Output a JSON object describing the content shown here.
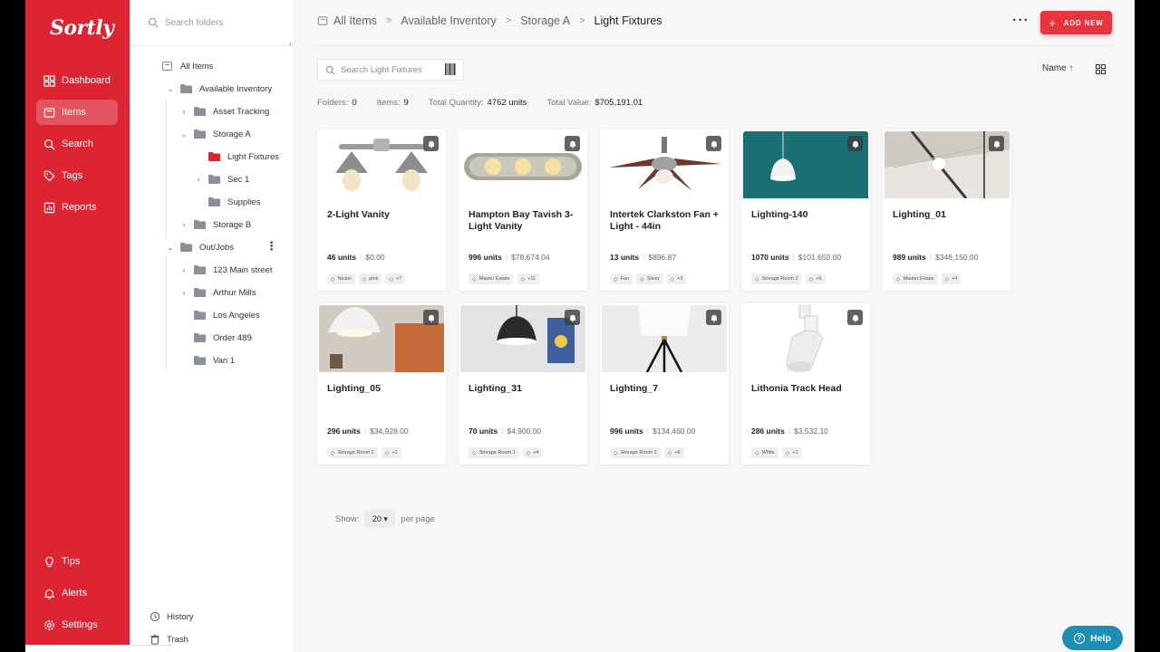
{
  "app": {
    "logo": "Sortly"
  },
  "nav": {
    "items": [
      {
        "label": "Dashboard",
        "icon": "dashboard-icon"
      },
      {
        "label": "Items",
        "icon": "items-icon",
        "active": true
      },
      {
        "label": "Search",
        "icon": "search-icon"
      },
      {
        "label": "Tags",
        "icon": "tag-icon"
      },
      {
        "label": "Reports",
        "icon": "reports-icon"
      }
    ],
    "bottom": [
      {
        "label": "Tips",
        "icon": "lightbulb-icon"
      },
      {
        "label": "Alerts",
        "icon": "bell-icon"
      },
      {
        "label": "Settings",
        "icon": "gear-icon"
      }
    ]
  },
  "tree": {
    "search_placeholder": "Search folders",
    "rows": [
      {
        "label": "All Items",
        "level": 0,
        "chevron": "",
        "kind": "all"
      },
      {
        "label": "Available Inventory",
        "level": 1,
        "chevron": "v",
        "kind": "folder"
      },
      {
        "label": "Asset Tracking",
        "level": 2,
        "chevron": ">",
        "kind": "folder"
      },
      {
        "label": "Storage A",
        "level": 2,
        "chevron": "v",
        "kind": "folder"
      },
      {
        "label": "Light Fixtures",
        "level": 3,
        "chevron": "",
        "kind": "folder-active"
      },
      {
        "label": "Sec 1",
        "level": 3,
        "chevron": ">",
        "kind": "folder"
      },
      {
        "label": "Supplies",
        "level": 3,
        "chevron": "",
        "kind": "folder"
      },
      {
        "label": "Storage B",
        "level": 2,
        "chevron": ">",
        "kind": "folder"
      },
      {
        "label": "Out/Jobs",
        "level": 1,
        "chevron": "v",
        "kind": "folder"
      },
      {
        "label": "123 Main street",
        "level": 2,
        "chevron": ">",
        "kind": "folder"
      },
      {
        "label": "Arthur Mills",
        "level": 2,
        "chevron": ">",
        "kind": "folder"
      },
      {
        "label": "Los Angeles",
        "level": 2,
        "chevron": "",
        "kind": "folder"
      },
      {
        "label": "Order 489",
        "level": 2,
        "chevron": "",
        "kind": "folder"
      },
      {
        "label": "Van 1",
        "level": 2,
        "chevron": "",
        "kind": "folder"
      }
    ],
    "history": "History",
    "trash": "Trash"
  },
  "breadcrumb": [
    "All Items",
    "Available Inventory",
    "Storage A",
    "Light Fixtures"
  ],
  "toolbar": {
    "add_new": "ADD NEW",
    "search_placeholder": "Search Light Fixtures",
    "sort_label": "Name ↑"
  },
  "stats": {
    "folders_label": "Folders:",
    "folders": "0",
    "items_label": "Items:",
    "items": "9",
    "qty_label": "Total Quantity:",
    "qty": "4762 units",
    "value_label": "Total Value:",
    "value": "$705,191.01"
  },
  "items": [
    {
      "name": "2-Light Vanity",
      "units": "46 units",
      "price": "$0.00",
      "tags": [
        "Nickel",
        "pink",
        "+7"
      ],
      "img": "vanity2"
    },
    {
      "name": "Hampton Bay Tavish 3-Light Vanity",
      "units": "996 units",
      "price": "$78,674.04",
      "tags": [
        "Master Estate",
        "+11"
      ],
      "img": "vanity3"
    },
    {
      "name": "Intertek Clarkston Fan + Light - 44in",
      "units": "13 units",
      "price": "$896.87",
      "tags": [
        "Fan",
        "Silver",
        "+3"
      ],
      "img": "fan"
    },
    {
      "name": "Lighting-140",
      "units": "1070 units",
      "price": "$101,650.00",
      "tags": [
        "Storage Room 2",
        "+6"
      ],
      "img": "teal"
    },
    {
      "name": "Lighting_01",
      "units": "989 units",
      "price": "$346,150.00",
      "tags": [
        "Master Estate",
        "+4"
      ],
      "img": "ceiling"
    },
    {
      "name": "Lighting_05",
      "units": "296 units",
      "price": "$34,928.00",
      "tags": [
        "Storage Room 2",
        "+1"
      ],
      "img": "pendant-white"
    },
    {
      "name": "Lighting_31",
      "units": "70 units",
      "price": "$4,900.00",
      "tags": [
        "Storage Room 1",
        "+4"
      ],
      "img": "pendant-black"
    },
    {
      "name": "Lighting_7",
      "units": "996 units",
      "price": "$134,460.00",
      "tags": [
        "Storage Room 2",
        "+8"
      ],
      "img": "floor-lamp"
    },
    {
      "name": "Lithonia Track Head",
      "units": "286 units",
      "price": "$3,532.10",
      "tags": [
        "White",
        "+1"
      ],
      "img": "track"
    }
  ],
  "pagination": {
    "show": "Show:",
    "value": "20",
    "per_page": "per page"
  },
  "help": "Help",
  "colors": {
    "brand": "#dc2433",
    "accent": "#e8343f",
    "help": "#1d8fb5"
  }
}
